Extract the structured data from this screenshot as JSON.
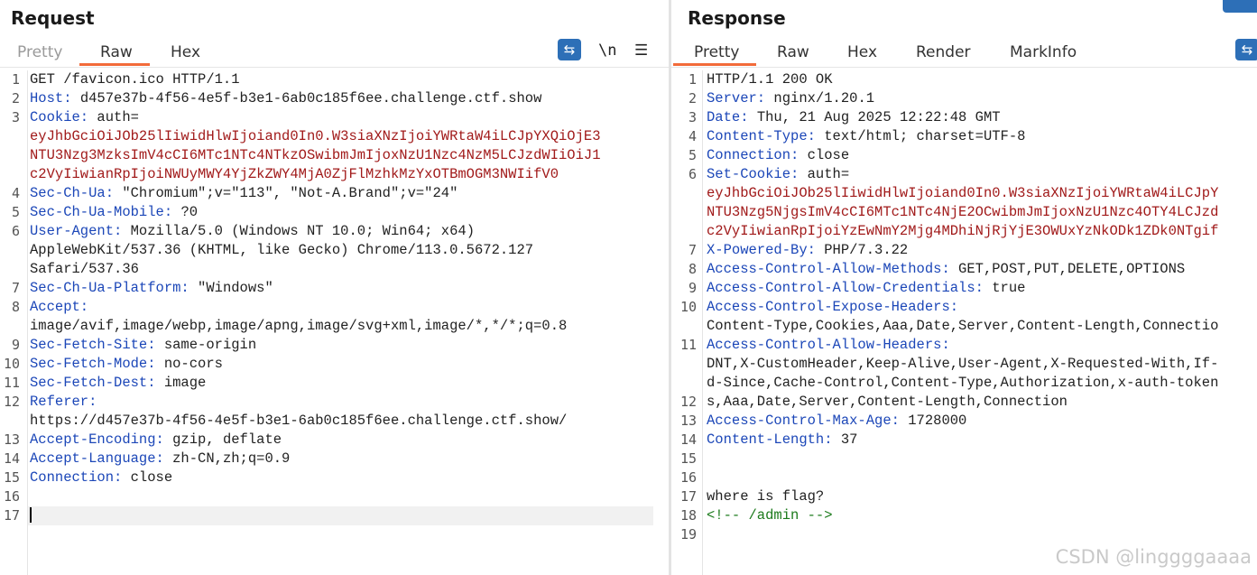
{
  "request": {
    "title": "Request",
    "tabs": [
      "Pretty",
      "Raw",
      "Hex"
    ],
    "active_tab": "Raw",
    "toolbar": {
      "wrap_icon": "wrap-icon",
      "newline_label": "\\n",
      "menu_icon": "hamburger-menu-icon"
    },
    "lines": [
      [
        {
          "t": "GET /favicon.ico HTTP/1.1",
          "c": "v"
        }
      ],
      [
        {
          "t": "Host:",
          "c": "k"
        },
        {
          "t": " d457e37b-4f56-4e5f-b3e1-6ab0c185f6ee.challenge.ctf.show",
          "c": "v"
        }
      ],
      [
        {
          "t": "Cookie:",
          "c": "k"
        },
        {
          "t": " auth=",
          "c": "v"
        }
      ],
      [
        {
          "t": "eyJhbGciOiJOb25lIiwidHlwIjoiand0In0.W3siaXNzIjoiYWRtaW4iLCJpYXQiOjE3",
          "c": "red"
        }
      ],
      [
        {
          "t": "NTU3Nzg3MzksImV4cCI6MTc1NTc4NTkzOSwibmJmIjoxNzU1Nzc4NzM5LCJzdWIiOiJ1",
          "c": "red"
        }
      ],
      [
        {
          "t": "c2VyIiwianRpIjoiNWUyMWY4YjZkZWY4MjA0ZjFlMzhkMzYxOTBmOGM3NWIifV0",
          "c": "red"
        }
      ],
      [
        {
          "t": "Sec-Ch-Ua:",
          "c": "k"
        },
        {
          "t": " \"Chromium\";v=\"113\", \"Not-A.Brand\";v=\"24\"",
          "c": "v"
        }
      ],
      [
        {
          "t": "Sec-Ch-Ua-Mobile:",
          "c": "k"
        },
        {
          "t": " ?0",
          "c": "v"
        }
      ],
      [
        {
          "t": "User-Agent:",
          "c": "k"
        },
        {
          "t": " Mozilla/5.0 (Windows NT 10.0; Win64; x64)",
          "c": "v"
        }
      ],
      [
        {
          "t": "AppleWebKit/537.36 (KHTML, like Gecko) Chrome/113.0.5672.127",
          "c": "v"
        }
      ],
      [
        {
          "t": "Safari/537.36",
          "c": "v"
        }
      ],
      [
        {
          "t": "Sec-Ch-Ua-Platform:",
          "c": "k"
        },
        {
          "t": " \"Windows\"",
          "c": "v"
        }
      ],
      [
        {
          "t": "Accept:",
          "c": "k"
        }
      ],
      [
        {
          "t": "image/avif,image/webp,image/apng,image/svg+xml,image/*,*/*;q=0.8",
          "c": "v"
        }
      ],
      [
        {
          "t": "Sec-Fetch-Site:",
          "c": "k"
        },
        {
          "t": " same-origin",
          "c": "v"
        }
      ],
      [
        {
          "t": "Sec-Fetch-Mode:",
          "c": "k"
        },
        {
          "t": " no-cors",
          "c": "v"
        }
      ],
      [
        {
          "t": "Sec-Fetch-Dest:",
          "c": "k"
        },
        {
          "t": " image",
          "c": "v"
        }
      ],
      [
        {
          "t": "Referer:",
          "c": "k"
        }
      ],
      [
        {
          "t": "https://d457e37b-4f56-4e5f-b3e1-6ab0c185f6ee.challenge.ctf.show/",
          "c": "v"
        }
      ],
      [
        {
          "t": "Accept-Encoding:",
          "c": "k"
        },
        {
          "t": " gzip, deflate",
          "c": "v"
        }
      ],
      [
        {
          "t": "Accept-Language:",
          "c": "k"
        },
        {
          "t": " zh-CN,zh;q=0.9",
          "c": "v"
        }
      ],
      [
        {
          "t": "Connection:",
          "c": "k"
        },
        {
          "t": " close",
          "c": "v"
        }
      ],
      [],
      []
    ],
    "line_numbers": [
      "1",
      "2",
      "3",
      "",
      "",
      "",
      "4",
      "5",
      "6",
      "",
      "",
      "7",
      "8",
      "",
      "9",
      "10",
      "11",
      "12",
      "",
      "13",
      "14",
      "15",
      "16",
      "17"
    ]
  },
  "response": {
    "title": "Response",
    "tabs": [
      "Pretty",
      "Raw",
      "Hex",
      "Render",
      "MarkInfo"
    ],
    "active_tab": "Pretty",
    "toolbar": {
      "wrap_icon": "wrap-icon"
    },
    "lines": [
      [
        {
          "t": "HTTP/1.1 200 OK",
          "c": "v"
        }
      ],
      [
        {
          "t": "Server:",
          "c": "k"
        },
        {
          "t": " nginx/1.20.1",
          "c": "v"
        }
      ],
      [
        {
          "t": "Date:",
          "c": "k"
        },
        {
          "t": " Thu, 21 Aug 2025 12:22:48 GMT",
          "c": "v"
        }
      ],
      [
        {
          "t": "Content-Type:",
          "c": "k"
        },
        {
          "t": " text/html; charset=UTF-8",
          "c": "v"
        }
      ],
      [
        {
          "t": "Connection:",
          "c": "k"
        },
        {
          "t": " close",
          "c": "v"
        }
      ],
      [
        {
          "t": "Set-Cookie:",
          "c": "k"
        },
        {
          "t": " auth=",
          "c": "v"
        }
      ],
      [
        {
          "t": "eyJhbGciOiJOb25lIiwidHlwIjoiand0In0.W3siaXNzIjoiYWRtaW4iLCJpY",
          "c": "red"
        }
      ],
      [
        {
          "t": "NTU3Nzg5NjgsImV4cCI6MTc1NTc4NjE2OCwibmJmIjoxNzU1Nzc4OTY4LCJzd",
          "c": "red"
        }
      ],
      [
        {
          "t": "c2VyIiwianRpIjoiYzEwNmY2Mjg4MDhiNjRjYjE3OWUxYzNkODk1ZDk0NTgif",
          "c": "red"
        }
      ],
      [
        {
          "t": "X-Powered-By:",
          "c": "k"
        },
        {
          "t": " PHP/7.3.22",
          "c": "v"
        }
      ],
      [
        {
          "t": "Access-Control-Allow-Methods:",
          "c": "k"
        },
        {
          "t": " GET,POST,PUT,DELETE,OPTIONS",
          "c": "v"
        }
      ],
      [
        {
          "t": "Access-Control-Allow-Credentials:",
          "c": "k"
        },
        {
          "t": " true",
          "c": "v"
        }
      ],
      [
        {
          "t": "Access-Control-Expose-Headers:",
          "c": "k"
        }
      ],
      [
        {
          "t": "Content-Type,Cookies,Aaa,Date,Server,Content-Length,Connectio",
          "c": "v"
        }
      ],
      [
        {
          "t": "Access-Control-Allow-Headers:",
          "c": "k"
        }
      ],
      [
        {
          "t": "DNT,X-CustomHeader,Keep-Alive,User-Agent,X-Requested-With,If-",
          "c": "v"
        }
      ],
      [
        {
          "t": "d-Since,Cache-Control,Content-Type,Authorization,x-auth-token",
          "c": "v"
        }
      ],
      [
        {
          "t": "s,Aaa,Date,Server,Content-Length,Connection",
          "c": "v"
        }
      ],
      [
        {
          "t": "Access-Control-Max-Age:",
          "c": "k"
        },
        {
          "t": " 1728000",
          "c": "v"
        }
      ],
      [
        {
          "t": "Content-Length:",
          "c": "k"
        },
        {
          "t": " 37",
          "c": "v"
        }
      ],
      [],
      [],
      [
        {
          "t": "where is flag?",
          "c": "v"
        }
      ],
      [
        {
          "t": "<!-- /admin -->",
          "c": "cm"
        }
      ],
      [],
      []
    ],
    "line_numbers": [
      "1",
      "2",
      "3",
      "4",
      "5",
      "6",
      "",
      "",
      "",
      "7",
      "8",
      "9",
      "10",
      "",
      "11",
      "",
      "",
      "12",
      "13",
      "14",
      "15",
      "16",
      "17",
      "18",
      "19"
    ]
  },
  "watermark": "CSDN @linggggaaaa"
}
